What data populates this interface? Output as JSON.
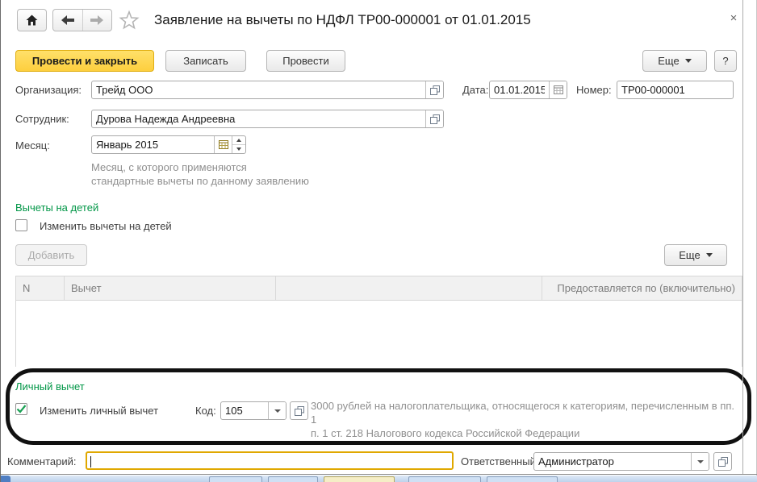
{
  "window": {
    "title": "Заявление на вычеты по НДФЛ ТР00-000001 от 01.01.2015",
    "close": "×"
  },
  "toolbar": {
    "post_and_close": "Провести и закрыть",
    "write": "Записать",
    "post": "Провести",
    "more": "Еще",
    "help": "?"
  },
  "form": {
    "organization_label": "Организация:",
    "organization_value": "Трейд ООО",
    "date_label": "Дата:",
    "date_value": "01.01.2015",
    "number_label": "Номер:",
    "number_value": "ТР00-000001",
    "employee_label": "Сотрудник:",
    "employee_value": "Дурова Надежда Андреевна",
    "month_label": "Месяц:",
    "month_value": "Январь 2015",
    "month_hint_lines": [
      "Месяц, с которого применяются",
      "стандартные вычеты по данному заявлению"
    ]
  },
  "children_deductions": {
    "section_title": "Вычеты на детей",
    "change_checkbox_label": "Изменить вычеты на детей",
    "change_checkbox_checked": false,
    "add_button": "Добавить",
    "more_button": "Еще",
    "table_columns": [
      "N",
      "Вычет",
      "",
      "Предоставляется по (включительно)"
    ],
    "table_rows": []
  },
  "personal_deduction": {
    "section_title": "Личный вычет",
    "change_checkbox_label": "Изменить личный вычет",
    "change_checkbox_checked": true,
    "code_label": "Код:",
    "code_value": "105",
    "description_lines": [
      "3000 рублей на налогоплательщика, относящегося к категориям, перечисленным в пп. 1",
      "п. 1 ст. 218 Налогового кодекса Российской Федерации"
    ]
  },
  "footer": {
    "comment_label": "Комментарий:",
    "comment_value": "",
    "responsible_label": "Ответственный:",
    "responsible_value": "Администратор"
  },
  "colors": {
    "section_title_green": "#009646",
    "primary_button_yellow": "#fdcf3e",
    "focused_field_border": "#e0a800",
    "annotation_stroke": "#111111"
  }
}
